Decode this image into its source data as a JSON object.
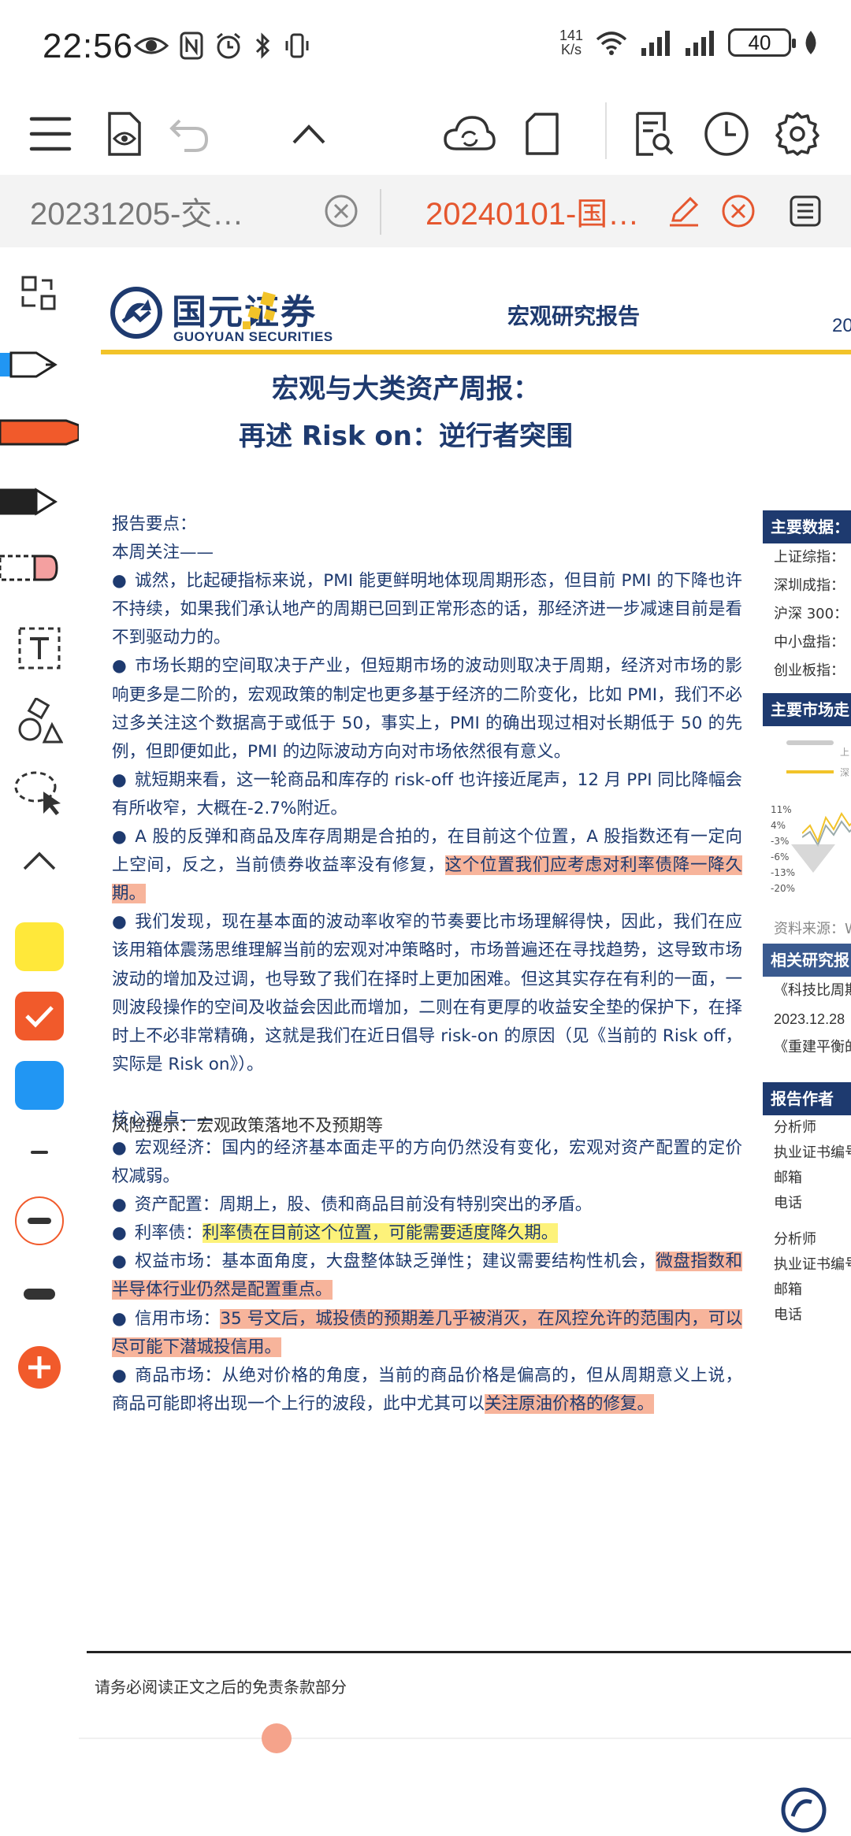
{
  "status_bar": {
    "time": "22:56",
    "net_speed_value": "141",
    "net_speed_unit": "K/s",
    "battery": "40"
  },
  "tabs": [
    {
      "label": "20231205-交…",
      "active": false
    },
    {
      "label": "20240101-国…",
      "active": true
    }
  ],
  "rail": {
    "swatch_colors": [
      "#FFE83A",
      "#F15A2B",
      "#2196F3"
    ]
  },
  "document": {
    "logo_cn": "国元证券",
    "logo_en": "GUOYUAN SECURITIES",
    "report_type": "宏观研究报告",
    "date_fragment": "20",
    "title_line1": "宏观与大类资产周报：",
    "title_line2": "再述 Risk on：逆行者突围",
    "summary_label": "报告要点：",
    "week_focus_label": "本周关注——",
    "week_focus": [
      {
        "text": "诚然，比起硬指标来说，PMI 能更鲜明地体现周期形态，但目前 PMI 的下降也许不持续，如果我们承认地产的周期已回到正常形态的话，那经济进一步减速目前是看不到驱动力的。"
      },
      {
        "text": "市场长期的空间取决于产业，但短期市场的波动则取决于周期，经济对市场的影响更多是二阶的，宏观政策的制定也更多基于经济的二阶变化，比如 PMI，我们不必过多关注这个数据高于或低于 50，事实上，PMI 的确出现过相对长期低于 50 的先例，但即便如此，PMI 的边际波动方向对市场依然很有意义。"
      },
      {
        "text": "就短期来看，这一轮商品和库存的 risk-off 也许接近尾声，12 月 PPI 同比降幅会有所收窄，大概在-2.7%附近。"
      },
      {
        "text": "A 股的反弹和商品及库存周期是合拍的，在目前这个位置，A 股指数还有一定向上空间，反之，当前债券收益率没有修复，",
        "highlight": "这个位置我们应考虑对利率债降一降久期。"
      },
      {
        "text": "我们发现，现在基本面的波动率收窄的节奏要比市场理解得快，因此，我们在应该用箱体震荡思维理解当前的宏观对冲策略时，市场普遍还在寻找趋势，这导致市场波动的增加及过调，也导致了我们在择时上更加困难。但这其实存在有利的一面，一则波段操作的空间及收益会因此而增加，二则在有更厚的收益安全垫的保护下，在择时上不必非常精确，这就是我们在近日倡导 risk-on 的原因（见《当前的 Risk off，实际是 Risk on》）。"
      }
    ],
    "core_views_label": "核心观点——",
    "core_views": [
      {
        "label": "宏观经济：",
        "text": "国内的经济基本面走平的方向仍然没有变化，宏观对资产配置的定价权减弱。"
      },
      {
        "label": "资产配置：",
        "text": "周期上，股、债和商品目前没有特别突出的矛盾。"
      },
      {
        "label": "利率债：",
        "highlight_yellow": "利率债在目前这个位置，可能需要适度降久期。"
      },
      {
        "label": "权益市场：",
        "text": "基本面角度，大盘整体缺乏弹性；建议需要结构性机会，",
        "highlight": "微盘指数和半导体行业仍然是配置重点。"
      },
      {
        "label": "信用市场：",
        "highlight": "35 号文后，城投债的预期差几乎被消灭，在风控允许的范围内，可以尽可能下潜城投信用。"
      },
      {
        "label": "商品市场：",
        "text": "从绝对价格的角度，当前的商品价格是偏高的，但从周期意义上说，商品可能即将出现一个上行的波段，此中尤其可以",
        "highlight": "关注原油价格的修复。"
      }
    ],
    "risk_label": "风险提示：",
    "risk_text": "宏观政策落地不及预期等",
    "footer_text": "请务必阅读正文之后的免责条款部分",
    "side": {
      "main_data_head": "主要数据：",
      "indices": [
        "上证综指：",
        "深圳成指：",
        "沪深 300：",
        "中小盘指：",
        "创业板指："
      ],
      "market_head": "主要市场走",
      "chart_tick_labels": [
        "11%",
        "4%",
        "-3%",
        "-6%",
        "-13%",
        "-20%"
      ],
      "chart_legend": [
        "上",
        "深"
      ],
      "source": "资料来源：Wi",
      "related_head": "相关研究报",
      "related": [
        "《科技比周期",
        "2023.12.28",
        "《重建平衡的"
      ],
      "author_head": "报告作者",
      "author_rows": [
        "分析师",
        "执业证书编号",
        "邮箱",
        "电话",
        "分析师",
        "执业证书编号",
        "邮箱",
        "电话"
      ]
    }
  }
}
